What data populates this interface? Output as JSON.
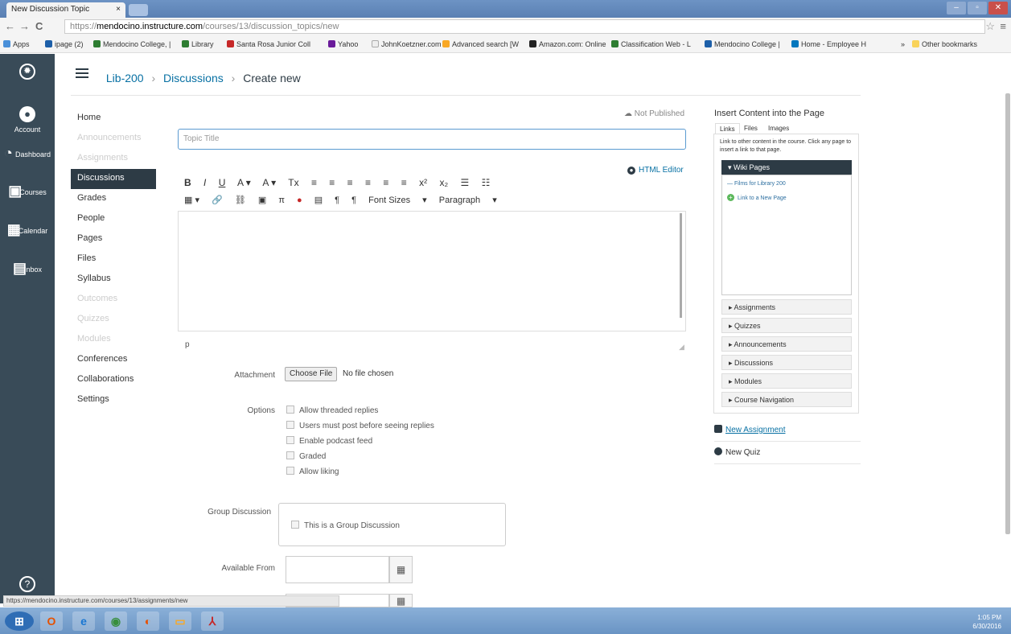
{
  "browser": {
    "tab_title": "New Discussion Topic",
    "tab_close": "×",
    "window_buttons": [
      "–",
      "▫",
      "✕"
    ],
    "url_scheme": "https://",
    "url_host": "mendocino.instructure.com",
    "url_path": "/courses/13/discussion_topics/new",
    "bookmarks": [
      "Apps",
      "ipage (2)",
      "Mendocino College, |",
      "Library",
      "Santa Rosa Junior Coll",
      "Yahoo",
      "JohnKoetzner.com",
      "Advanced search [W",
      "Amazon.com: Online",
      "Classification Web - L",
      "Mendocino College |",
      "Home - Employee H"
    ],
    "bookmarks_more": "»",
    "other_bookmarks": "Other bookmarks",
    "status_url": "https://mendocino.instructure.com/courses/13/assignments/new"
  },
  "global_nav": {
    "items": [
      {
        "label": "Account",
        "icon": "account-icon"
      },
      {
        "label": "Dashboard",
        "icon": "dashboard-icon"
      },
      {
        "label": "Courses",
        "icon": "courses-icon"
      },
      {
        "label": "Calendar",
        "icon": "calendar-icon"
      },
      {
        "label": "Inbox",
        "icon": "inbox-icon"
      }
    ],
    "help": "?"
  },
  "breadcrumb": {
    "course": "Lib-200",
    "section": "Discussions",
    "page": "Create new",
    "sep": "›"
  },
  "course_nav": [
    {
      "label": "Home",
      "state": "normal"
    },
    {
      "label": "Announcements",
      "state": "disabled"
    },
    {
      "label": "Assignments",
      "state": "disabled"
    },
    {
      "label": "Discussions",
      "state": "active"
    },
    {
      "label": "Grades",
      "state": "normal"
    },
    {
      "label": "People",
      "state": "normal"
    },
    {
      "label": "Pages",
      "state": "normal"
    },
    {
      "label": "Files",
      "state": "normal"
    },
    {
      "label": "Syllabus",
      "state": "normal"
    },
    {
      "label": "Outcomes",
      "state": "disabled"
    },
    {
      "label": "Quizzes",
      "state": "disabled"
    },
    {
      "label": "Modules",
      "state": "disabled"
    },
    {
      "label": "Conferences",
      "state": "normal"
    },
    {
      "label": "Collaborations",
      "state": "normal"
    },
    {
      "label": "Settings",
      "state": "normal"
    }
  ],
  "form": {
    "publish_status": "Not Published",
    "title_placeholder": "Topic Title",
    "html_editor": "HTML Editor",
    "toolbar1": [
      "B",
      "I",
      "U",
      "A ▾",
      "A ▾",
      "Tx",
      "≡",
      "≡",
      "≡",
      "≡",
      "≡",
      "≡",
      "x²",
      "x₂",
      "☰",
      "☷"
    ],
    "toolbar2": [
      "▦ ▾",
      "🔗",
      "⛓",
      "▣",
      "π",
      "●",
      "▤",
      "¶",
      "¶",
      "Font Sizes",
      "▾",
      "Paragraph",
      "▾"
    ],
    "path_label": "p",
    "attachment_label": "Attachment",
    "choose_file": "Choose File",
    "no_file": "No file chosen",
    "options_label": "Options",
    "options": [
      "Allow threaded replies",
      "Users must post before seeing replies",
      "Enable podcast feed",
      "Graded",
      "Allow liking"
    ],
    "group_label": "Group Discussion",
    "group_option": "This is a Group Discussion",
    "available_from": "Available From",
    "cal_icon": "▦"
  },
  "sidebar": {
    "title": "Insert Content into the Page",
    "tabs": [
      "Links",
      "Files",
      "Images"
    ],
    "description": "Link to other content in the course. Click any page to insert a link to that page.",
    "wiki_header": "▾ Wiki Pages",
    "wiki_links": [
      "— Films for Library 200",
      "Link to a New Page"
    ],
    "accordions": [
      "▸ Assignments",
      "▸ Quizzes",
      "▸ Announcements",
      "▸ Discussions",
      "▸ Modules",
      "▸ Course Navigation"
    ],
    "new_assignment": "New Assignment",
    "new_quiz": "New Quiz"
  },
  "taskbar": {
    "time": "1:05 PM",
    "date": "6/30/2016"
  }
}
